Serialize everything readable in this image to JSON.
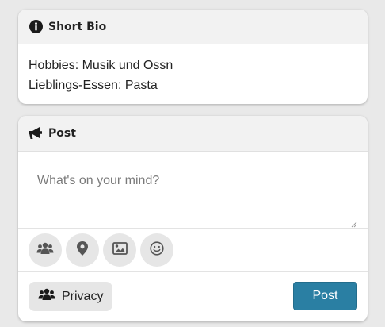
{
  "bio_card": {
    "title": "Short Bio",
    "header_icon": "info-circle-icon",
    "lines": [
      "Hobbies: Musik und Ossn",
      "Lieblings-Essen: Pasta"
    ]
  },
  "post_card": {
    "title": "Post",
    "header_icon": "megaphone-icon",
    "input": {
      "value": "",
      "placeholder": "What's on your mind?"
    },
    "tools": [
      {
        "icon": "users-icon"
      },
      {
        "icon": "location-pin-icon"
      },
      {
        "icon": "image-icon"
      },
      {
        "icon": "smiley-icon"
      }
    ],
    "privacy_label": "Privacy",
    "privacy_icon": "users-icon",
    "post_label": "Post"
  },
  "colors": {
    "background": "#e9e9e9",
    "card_header": "#f2f2f2",
    "primary_button": "#2a7fa3",
    "tool_button": "#e6e6e6"
  }
}
